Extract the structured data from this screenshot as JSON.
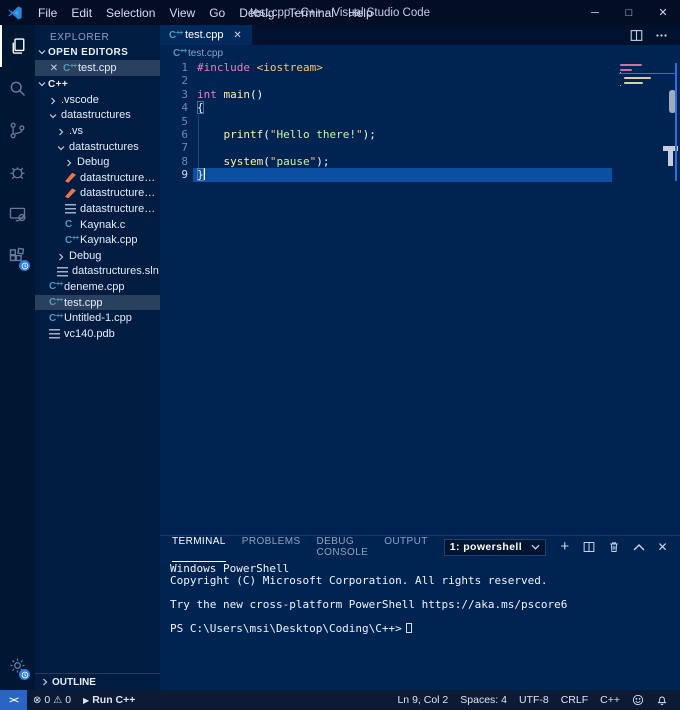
{
  "theme": {
    "colors": {
      "titlebar_bg": "#030d24",
      "activitybar_bg": "#001733",
      "sidebar_bg": "#001c40",
      "editor_bg": "#002451",
      "tabbar_bg": "#00122e",
      "tab_active_bg": "#01295c",
      "statusbar_bg": "#0d1a36",
      "remote_bg": "#2a65c6",
      "badge_bg": "#2b7de9",
      "line_number": "#7285b7",
      "dim": "#8da0c4",
      "selection_row": "rgba(255,255,255,0.16)",
      "current_line": "#0b4fa3"
    },
    "tokens": {
      "keyword": "#f17cb8",
      "type": "#ffc26e",
      "function": "#ffeead",
      "string": "#cdf1a2",
      "quote": "#ffc26e",
      "plain": "#f5f8ff"
    }
  },
  "titlebar": {
    "menus": [
      "File",
      "Edit",
      "Selection",
      "View",
      "Go",
      "Debug",
      "Terminal",
      "Help"
    ],
    "title": "test.cpp - C++ - Visual Studio Code",
    "window_controls": [
      {
        "id": "minimize",
        "glyph": "─"
      },
      {
        "id": "maximize",
        "glyph": "□"
      },
      {
        "id": "close",
        "glyph": "✕"
      }
    ]
  },
  "activitybar": {
    "top": [
      {
        "id": "explorer",
        "active": true
      },
      {
        "id": "search"
      },
      {
        "id": "source-control"
      },
      {
        "id": "debug"
      },
      {
        "id": "remote-monitor"
      },
      {
        "id": "extensions",
        "badge": true
      }
    ],
    "bottom": [
      {
        "id": "manage",
        "badge": true
      }
    ]
  },
  "sidebar": {
    "title": "EXPLORER",
    "open_editors": {
      "header": "OPEN EDITORS",
      "items": [
        {
          "label": "test.cpp",
          "icon": "cpp",
          "selected": true
        }
      ]
    },
    "folder_header": "C++",
    "tree": [
      {
        "label": ".vscode",
        "depth": 1,
        "kind": "folder",
        "expanded": false
      },
      {
        "label": "datastructures",
        "depth": 1,
        "kind": "folder",
        "expanded": true
      },
      {
        "label": ".vs",
        "depth": 2,
        "kind": "folder",
        "expanded": false
      },
      {
        "label": "datastructures",
        "depth": 2,
        "kind": "folder",
        "expanded": true
      },
      {
        "label": "Debug",
        "depth": 3,
        "kind": "folder",
        "expanded": false
      },
      {
        "label": "datastructures.vcxp...",
        "depth": 3,
        "kind": "file",
        "icon": "vcx"
      },
      {
        "label": "datastructures.vcxp...",
        "depth": 3,
        "kind": "file",
        "icon": "vcx"
      },
      {
        "label": "datastructures.vcxp...",
        "depth": 3,
        "kind": "file",
        "icon": "lines"
      },
      {
        "label": "Kaynak.c",
        "depth": 3,
        "kind": "file",
        "icon": "c"
      },
      {
        "label": "Kaynak.cpp",
        "depth": 3,
        "kind": "file",
        "icon": "cpp"
      },
      {
        "label": "Debug",
        "depth": 2,
        "kind": "folder",
        "expanded": false
      },
      {
        "label": "datastructures.sln",
        "depth": 2,
        "kind": "file",
        "icon": "lines"
      },
      {
        "label": "deneme.cpp",
        "depth": 1,
        "kind": "file",
        "icon": "cpp"
      },
      {
        "label": "test.cpp",
        "depth": 1,
        "kind": "file",
        "icon": "cpp",
        "selected": true
      },
      {
        "label": "Untitled-1.cpp",
        "depth": 1,
        "kind": "file",
        "icon": "cpp"
      },
      {
        "label": "vc140.pdb",
        "depth": 1,
        "kind": "file",
        "icon": "lines"
      }
    ],
    "outline_header": "OUTLINE"
  },
  "editor": {
    "tab": {
      "label": "test.cpp",
      "icon": "cpp"
    },
    "breadcrumb": {
      "label": "test.cpp",
      "icon": "cpp"
    },
    "lines": [
      {
        "n": "1",
        "tokens": [
          {
            "t": "#include",
            "c": "keyword"
          },
          {
            "t": " ",
            "c": "plain"
          },
          {
            "t": "<iostream>",
            "c": "type"
          }
        ]
      },
      {
        "n": "2",
        "tokens": []
      },
      {
        "n": "3",
        "tokens": [
          {
            "t": "int",
            "c": "keyword"
          },
          {
            "t": " ",
            "c": "plain"
          },
          {
            "t": "main",
            "c": "function"
          },
          {
            "t": "()",
            "c": "plain"
          }
        ]
      },
      {
        "n": "4",
        "tokens": [
          {
            "t": "{",
            "c": "plain",
            "bracket": true
          }
        ]
      },
      {
        "n": "5",
        "tokens": []
      },
      {
        "n": "6",
        "tokens": [
          {
            "t": "    ",
            "c": "plain"
          },
          {
            "t": "printf",
            "c": "function"
          },
          {
            "t": "(",
            "c": "plain"
          },
          {
            "t": "\"",
            "c": "quote"
          },
          {
            "t": "Hello there!",
            "c": "string"
          },
          {
            "t": "\"",
            "c": "quote"
          },
          {
            "t": ");",
            "c": "plain"
          }
        ]
      },
      {
        "n": "7",
        "tokens": []
      },
      {
        "n": "8",
        "tokens": [
          {
            "t": "    ",
            "c": "plain"
          },
          {
            "t": "system",
            "c": "function"
          },
          {
            "t": "(",
            "c": "plain"
          },
          {
            "t": "\"",
            "c": "quote"
          },
          {
            "t": "pause",
            "c": "string"
          },
          {
            "t": "\"",
            "c": "quote"
          },
          {
            "t": ");",
            "c": "plain"
          }
        ]
      },
      {
        "n": "9",
        "tokens": [
          {
            "t": "}",
            "c": "plain",
            "bracket": true
          }
        ],
        "current": true,
        "cursor": true
      }
    ]
  },
  "panel": {
    "tabs": [
      {
        "label": "TERMINAL",
        "active": true
      },
      {
        "label": "PROBLEMS"
      },
      {
        "label": "DEBUG CONSOLE"
      },
      {
        "label": "OUTPUT"
      }
    ],
    "dropdown_value": "1: powershell",
    "terminal_lines": [
      "Windows PowerShell",
      "Copyright (C) Microsoft Corporation. All rights reserved.",
      "",
      "Try the new cross-platform PowerShell https://aka.ms/pscore6",
      "",
      "PS C:\\Users\\msi\\Desktop\\Coding\\C++>"
    ]
  },
  "statusbar": {
    "errors": "0",
    "warnings": "0",
    "run_label": "Run C++",
    "right_items": [
      "Ln 9, Col 2",
      "Spaces: 4",
      "UTF-8",
      "CRLF",
      "C++"
    ]
  }
}
